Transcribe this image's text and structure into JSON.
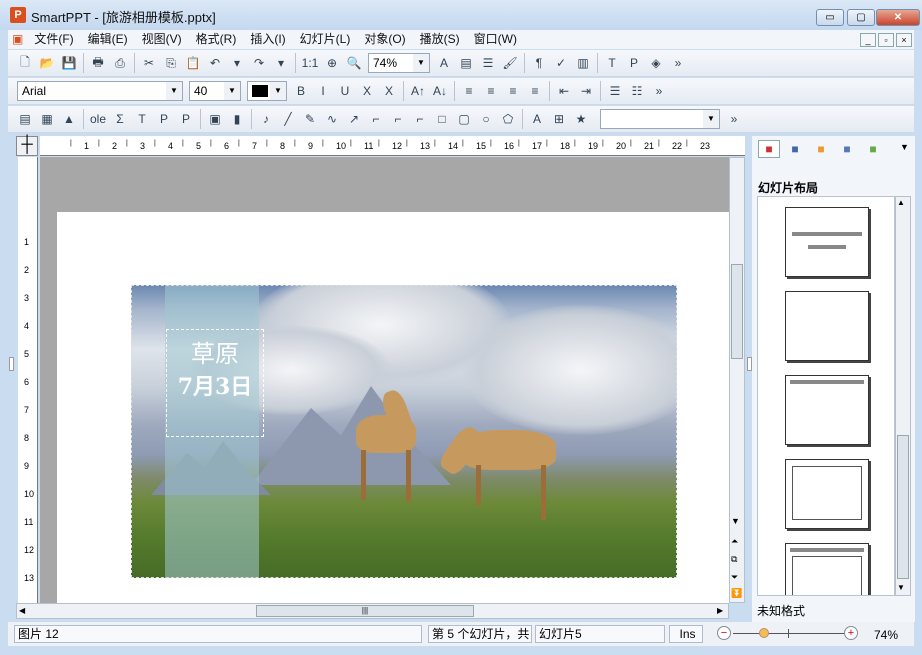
{
  "window": {
    "title": "SmartPPT - [旅游相册模板.pptx]",
    "app_icon": "P",
    "min": "▭",
    "max": "▢",
    "close": "✕"
  },
  "menu": [
    "文件(F)",
    "编辑(E)",
    "视图(V)",
    "格式(R)",
    "插入(I)",
    "幻灯片(L)",
    "对象(O)",
    "播放(S)",
    "窗口(W)"
  ],
  "toolbar1": {
    "icons": [
      "new-file-icon",
      "open-folder-icon",
      "save-icon",
      "|",
      "print-icon",
      "export-pdf-icon",
      "|",
      "cut-icon",
      "copy-icon",
      "paste-icon",
      "undo-icon",
      "undo-dropdown-icon",
      "redo-icon",
      "redo-dropdown-icon",
      "|",
      "actual-size-icon",
      "zoom-fit-icon",
      "zoom-icon"
    ],
    "zoom": "74%",
    "icons2": [
      "font-color-icon",
      "format-painter-icon",
      "list-format-icon",
      "brush-icon",
      "|",
      "paragraph-mark-icon",
      "spell-check-icon",
      "chart-tool-icon",
      "|",
      "text-box-icon",
      "page-icon",
      "3d-icon"
    ]
  },
  "toolbar2": {
    "font": "Arial",
    "size": "40",
    "icons": [
      "bold-icon",
      "italic-icon",
      "underline-icon",
      "strikethrough-icon",
      "clear-format-icon",
      "|",
      "grow-font-icon",
      "shrink-font-icon",
      "|",
      "align-left-icon",
      "align-center-icon",
      "align-right-icon",
      "justify-icon",
      "|",
      "decrease-indent-icon",
      "increase-indent-icon",
      "|",
      "bullet-list-icon",
      "numbered-list-icon"
    ],
    "glyphs": [
      "B",
      "I",
      "U",
      "X",
      "X",
      "A↑",
      "A↓",
      "≡",
      "≡",
      "≡",
      "≡",
      "⇤",
      "⇥",
      "☰",
      "☷"
    ]
  },
  "toolbar3": {
    "icons": [
      "insert-textbox-icon",
      "insert-table-icon",
      "insert-picture-icon",
      "|",
      "insert-ole-icon",
      "insert-formula-icon",
      "insert-title-icon",
      "insert-placeholder-icon",
      "insert-page-icon",
      "|",
      "insert-video-icon",
      "insert-audio-icon",
      "|",
      "line-icon",
      "pencil-icon",
      "curve-icon",
      "arrow-icon",
      "connector-icon",
      "elbow-connector-icon",
      "curved-connector-icon",
      "rectangle-icon",
      "rounded-rect-icon",
      "ellipse-icon",
      "shapes-icon",
      "wordart-icon",
      "|",
      "group-icon",
      "star-icon",
      "ungroup-icon"
    ],
    "glyphs": [
      "▤",
      "▦",
      "▲",
      "ole",
      "Σ",
      "T",
      "P",
      "P",
      "▣",
      "▮",
      "♪",
      "╱",
      "✎",
      "∿",
      "↗",
      "⌐",
      "⌐",
      "⌐",
      "□",
      "▢",
      "○",
      "⬠",
      "A",
      "⊞",
      "★",
      "⊟"
    ],
    "style_select": ""
  },
  "hruler": [
    "1",
    "2",
    "3",
    "4",
    "5",
    "6",
    "7",
    "8",
    "9",
    "10",
    "11",
    "12",
    "13",
    "14",
    "15",
    "16",
    "17",
    "18",
    "19",
    "20",
    "21",
    "22",
    "23"
  ],
  "vruler": [
    "1",
    "2",
    "3",
    "4",
    "5",
    "6",
    "7",
    "8",
    "9",
    "10",
    "11",
    "12",
    "13"
  ],
  "slide": {
    "text_line1": "草原",
    "text_line2": "7月3日"
  },
  "right_panel": {
    "title": "幻灯片布局",
    "selected_layout": "未知格式",
    "tab_icons": [
      "layout-tab-icon",
      "design-tab-icon",
      "color-tab-icon",
      "background-tab-icon",
      "animation-tab-icon"
    ]
  },
  "status": {
    "object": "图片 12",
    "slide_pos": "第 5 个幻灯片，共",
    "slide_name": "幻灯片5",
    "mode": "Ins",
    "zoom": "74%",
    "zoom_percent": 74
  }
}
